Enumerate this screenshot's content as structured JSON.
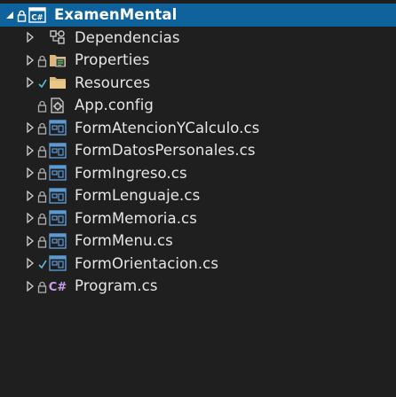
{
  "solution_tree": {
    "project": {
      "label": "ExamenMental",
      "icon": "csharp-project-icon",
      "expander": "expanded"
    },
    "items": [
      {
        "label": "Dependencias",
        "icon": "dependencies-icon",
        "expander": "collapsed",
        "locked": false
      },
      {
        "label": "Properties",
        "icon": "properties-folder-icon",
        "expander": "collapsed",
        "locked": true
      },
      {
        "label": "Resources",
        "icon": "folder-icon",
        "expander": "collapsed",
        "locked": true
      },
      {
        "label": "App.config",
        "icon": "config-file-icon",
        "expander": "none",
        "locked": true
      },
      {
        "label": "FormAtencionYCalculo.cs",
        "icon": "form-file-icon",
        "expander": "collapsed",
        "locked": true
      },
      {
        "label": "FormDatosPersonales.cs",
        "icon": "form-file-icon",
        "expander": "collapsed",
        "locked": true
      },
      {
        "label": "FormIngreso.cs",
        "icon": "form-file-icon",
        "expander": "collapsed",
        "locked": true
      },
      {
        "label": "FormLenguaje.cs",
        "icon": "form-file-icon",
        "expander": "collapsed",
        "locked": true
      },
      {
        "label": "FormMemoria.cs",
        "icon": "form-file-icon",
        "expander": "collapsed",
        "locked": true
      },
      {
        "label": "FormMenu.cs",
        "icon": "form-file-icon",
        "expander": "collapsed",
        "locked": true
      },
      {
        "label": "FormOrientacion.cs",
        "icon": "form-file-icon",
        "expander": "collapsed",
        "locked": true
      },
      {
        "label": "Program.cs",
        "icon": "csharp-file-icon",
        "expander": "collapsed",
        "locked": true
      }
    ]
  },
  "colors": {
    "selection": "#0e639c",
    "background": "#1f1f1f",
    "folder": "#dcb67a",
    "csharp": "#68217a",
    "form": "#5c9ad4"
  }
}
